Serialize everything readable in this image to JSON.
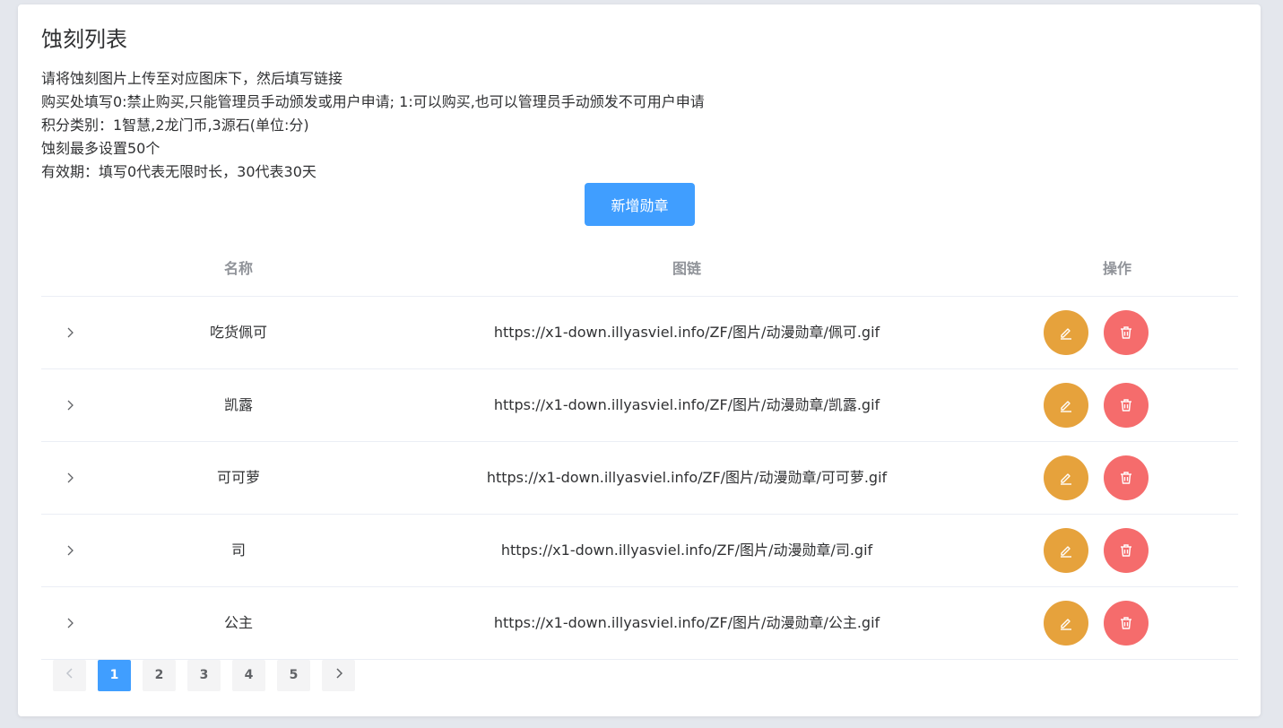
{
  "page": {
    "title": "蚀刻列表",
    "notes": [
      "请将蚀刻图片上传至对应图床下，然后填写链接",
      "购买处填写0:禁止购买,只能管理员手动颁发或用户申请; 1:可以购买,也可以管理员手动颁发不可用户申请",
      "积分类别：1智慧,2龙门币,3源石(单位:分)",
      "蚀刻最多设置50个",
      "有效期：填写0代表无限时长，30代表30天"
    ],
    "add_button_label": "新增勋章"
  },
  "table": {
    "headers": {
      "name": "名称",
      "url": "图链",
      "ops": "操作"
    },
    "rows": [
      {
        "name": "吃货佩可",
        "url": "https://x1-down.illyasviel.info/ZF/图片/动漫勋章/佩可.gif"
      },
      {
        "name": "凯露",
        "url": "https://x1-down.illyasviel.info/ZF/图片/动漫勋章/凯露.gif"
      },
      {
        "name": "可可萝",
        "url": "https://x1-down.illyasviel.info/ZF/图片/动漫勋章/可可萝.gif"
      },
      {
        "name": "司",
        "url": "https://x1-down.illyasviel.info/ZF/图片/动漫勋章/司.gif"
      },
      {
        "name": "公主",
        "url": "https://x1-down.illyasviel.info/ZF/图片/动漫勋章/公主.gif"
      }
    ],
    "row_icons": {
      "expand": "chevron-right-icon",
      "edit": "edit-icon",
      "delete": "trash-icon"
    }
  },
  "pagination": {
    "pages": [
      "1",
      "2",
      "3",
      "4",
      "5"
    ],
    "current": "1",
    "prev_icon": "chevron-left-icon",
    "next_icon": "chevron-right-icon"
  },
  "colors": {
    "primary": "#409eff",
    "warning": "#e6a23c",
    "danger": "#f56c6c",
    "background": "#e4e7ed"
  }
}
